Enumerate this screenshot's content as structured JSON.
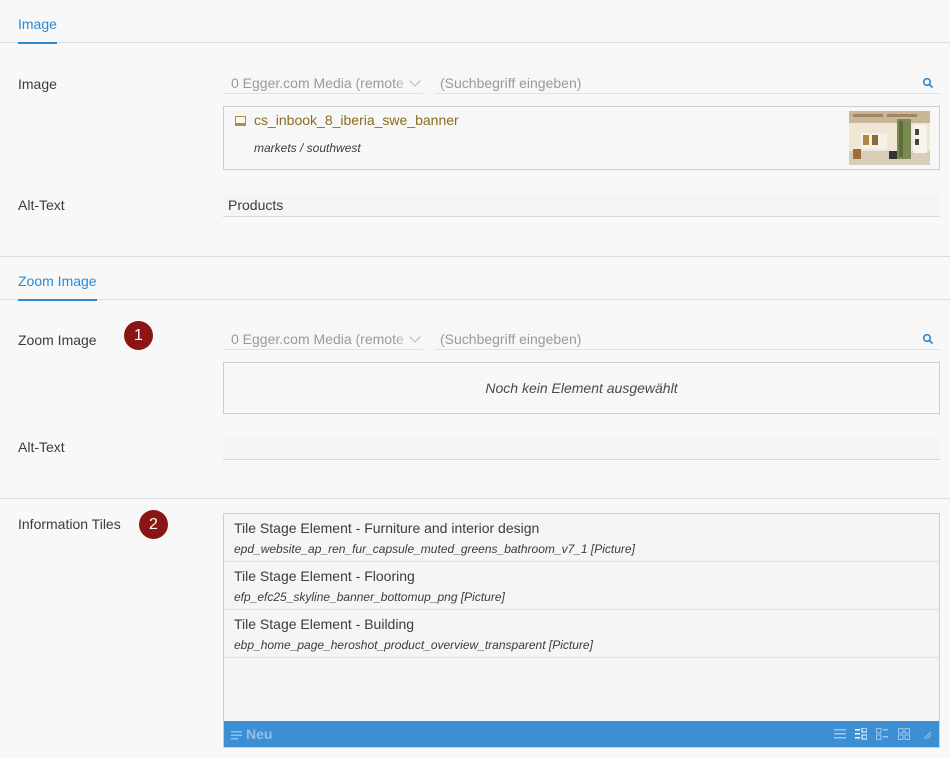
{
  "image_section": {
    "tab_label": "Image",
    "image_label": "Image",
    "repository_select": "0 Egger.com Media (remote",
    "search_placeholder": "(Suchbegriff eingeben)",
    "selected_media": {
      "name": "cs_inbook_8_iberia_swe_banner",
      "path": "markets / southwest"
    },
    "alt_label": "Alt-Text",
    "alt_value": "Products"
  },
  "zoom_section": {
    "tab_label": "Zoom Image",
    "image_label": "Zoom Image",
    "badge": "1",
    "repository_select": "0 Egger.com Media (remote",
    "search_placeholder": "(Suchbegriff eingeben)",
    "empty_text": "Noch kein Element ausgewählt",
    "alt_label": "Alt-Text",
    "alt_value": ""
  },
  "tiles_section": {
    "label": "Information Tiles",
    "badge": "2",
    "items": [
      {
        "title": "Tile Stage Element - Furniture and interior design",
        "subtitle": "epd_website_ap_ren_fur_capsule_muted_greens_bathroom_v7_1 [Picture]"
      },
      {
        "title": "Tile Stage Element - Flooring",
        "subtitle": "efp_efc25_skyline_banner_bottomup_png [Picture]"
      },
      {
        "title": "Tile Stage Element - Building",
        "subtitle": "ebp_home_page_heroshot_product_overview_transparent [Picture]"
      }
    ],
    "new_label": "Neu"
  },
  "colors": {
    "accent": "#2a8ad4",
    "badge": "#8b1414",
    "toolbar": "#3b8fd2",
    "media_link": "#8b6b1f"
  },
  "icons": {
    "search": "search-icon",
    "media": "picture-icon",
    "new": "new-list-icon",
    "views": [
      "list-view-icon",
      "tree-view-icon",
      "detail-view-icon",
      "grid-view-icon",
      "resize-icon"
    ]
  }
}
